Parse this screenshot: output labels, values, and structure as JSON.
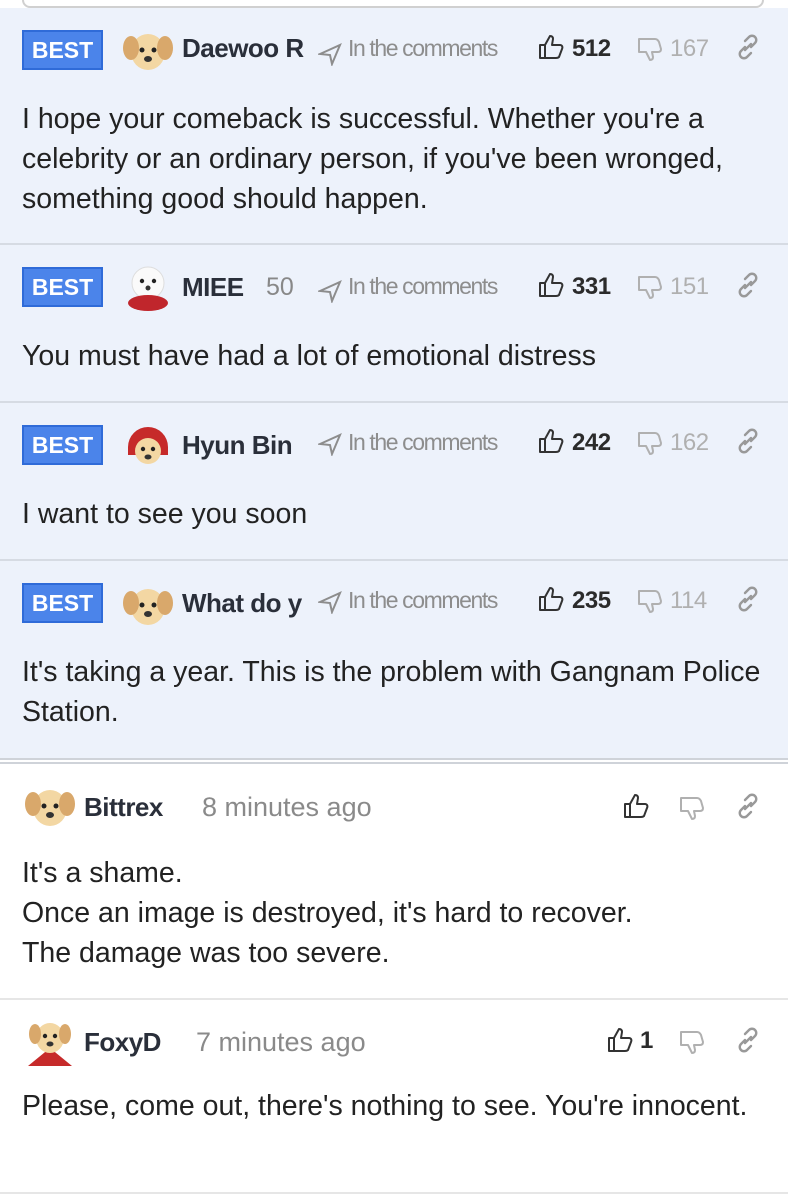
{
  "meta_label": "In the comments",
  "best_label": "BEST",
  "best_comments": [
    {
      "user": "Daewoo R",
      "level": "",
      "likes": "512",
      "dislikes": "167",
      "text": "I hope your comeback is successful. Whether you're a celebrity or an ordinary person, if you've been wronged, something good should happen.",
      "avatar": "puppy-icon"
    },
    {
      "user": "MIEE",
      "level": "50",
      "likes": "331",
      "dislikes": "151",
      "text": "You must have had a lot of emotional distress",
      "avatar": "white-dog-scarf-icon"
    },
    {
      "user": "Hyun Bin",
      "level": "",
      "likes": "242",
      "dislikes": "162",
      "text": "I want to see you soon",
      "avatar": "puppy-red-hood-icon"
    },
    {
      "user": "What do y",
      "level": "",
      "likes": "235",
      "dislikes": "114",
      "text": "It's taking a year. This is the problem with Gangnam Police Station.",
      "avatar": "puppy-icon"
    }
  ],
  "comments": [
    {
      "user": "Bittrex",
      "time": "8 minutes ago",
      "likes": "",
      "text": "It's a shame.\nOnce an image is destroyed, it's hard to recover.\nThe damage was too severe.",
      "avatar": "puppy-icon"
    },
    {
      "user": "FoxyD",
      "time": "7 minutes ago",
      "likes": "1",
      "text": "Please, come out, there's nothing to see. You're innocent.",
      "avatar": "puppy-red-cape-icon"
    }
  ],
  "colors": {
    "best_bg": "#edf2fb",
    "badge": "#4b84ea",
    "divider": "#d6dbe3"
  }
}
